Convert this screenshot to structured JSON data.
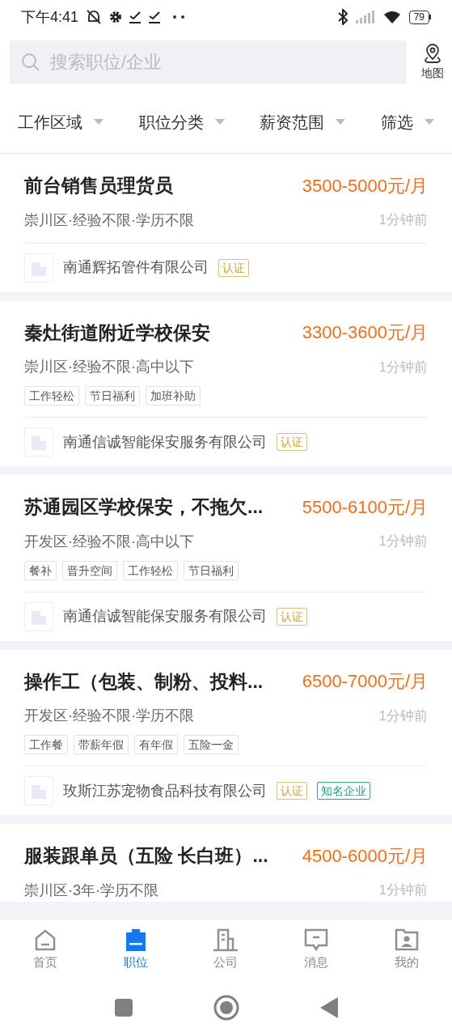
{
  "status_bar": {
    "time": "下午4:41",
    "battery": "79"
  },
  "search": {
    "placeholder": "搜索职位/企业",
    "map_label": "地图"
  },
  "filters": [
    {
      "label": "工作区域"
    },
    {
      "label": "职位分类"
    },
    {
      "label": "薪资范围"
    },
    {
      "label": "筛选"
    }
  ],
  "jobs": [
    {
      "title": "前台销售员理货员",
      "salary": "3500-5000元/月",
      "meta": "崇川区·经验不限·学历不限",
      "time": "1分钟前",
      "company": "南通辉拓管件有限公司",
      "badges": [
        {
          "label": "认证",
          "kind": "verified"
        }
      ]
    },
    {
      "title": "秦灶街道附近学校保安",
      "salary": "3300-3600元/月",
      "meta": "崇川区·经验不限·高中以下",
      "time": "1分钟前",
      "tags": [
        "工作轻松",
        "节日福利",
        "加班补助"
      ],
      "company": "南通信诚智能保安服务有限公司",
      "badges": [
        {
          "label": "认证",
          "kind": "verified"
        }
      ]
    },
    {
      "title": "苏通园区学校保安，不拖欠...",
      "salary": "5500-6100元/月",
      "meta": "开发区·经验不限·高中以下",
      "time": "1分钟前",
      "tags": [
        "餐补",
        "晋升空间",
        "工作轻松",
        "节日福利"
      ],
      "company": "南通信诚智能保安服务有限公司",
      "badges": [
        {
          "label": "认证",
          "kind": "verified"
        }
      ]
    },
    {
      "title": "操作工（包装、制粉、投料...",
      "salary": "6500-7000元/月",
      "meta": "开发区·经验不限·学历不限",
      "time": "1分钟前",
      "tags": [
        "工作餐",
        "带薪年假",
        "有年假",
        "五险一金"
      ],
      "company": "玫斯江苏宠物食品科技有限公司",
      "badges": [
        {
          "label": "认证",
          "kind": "verified"
        },
        {
          "label": "知名企业",
          "kind": "famous"
        }
      ]
    },
    {
      "title": "服装跟单员（五险 长白班）...",
      "salary": "4500-6000元/月",
      "meta": "崇川区·3年·学历不限",
      "time": "1分钟前"
    }
  ],
  "tabs": [
    {
      "label": "首页",
      "selected": false
    },
    {
      "label": "职位",
      "selected": true
    },
    {
      "label": "公司",
      "selected": false
    },
    {
      "label": "消息",
      "selected": false
    },
    {
      "label": "我的",
      "selected": false
    }
  ]
}
